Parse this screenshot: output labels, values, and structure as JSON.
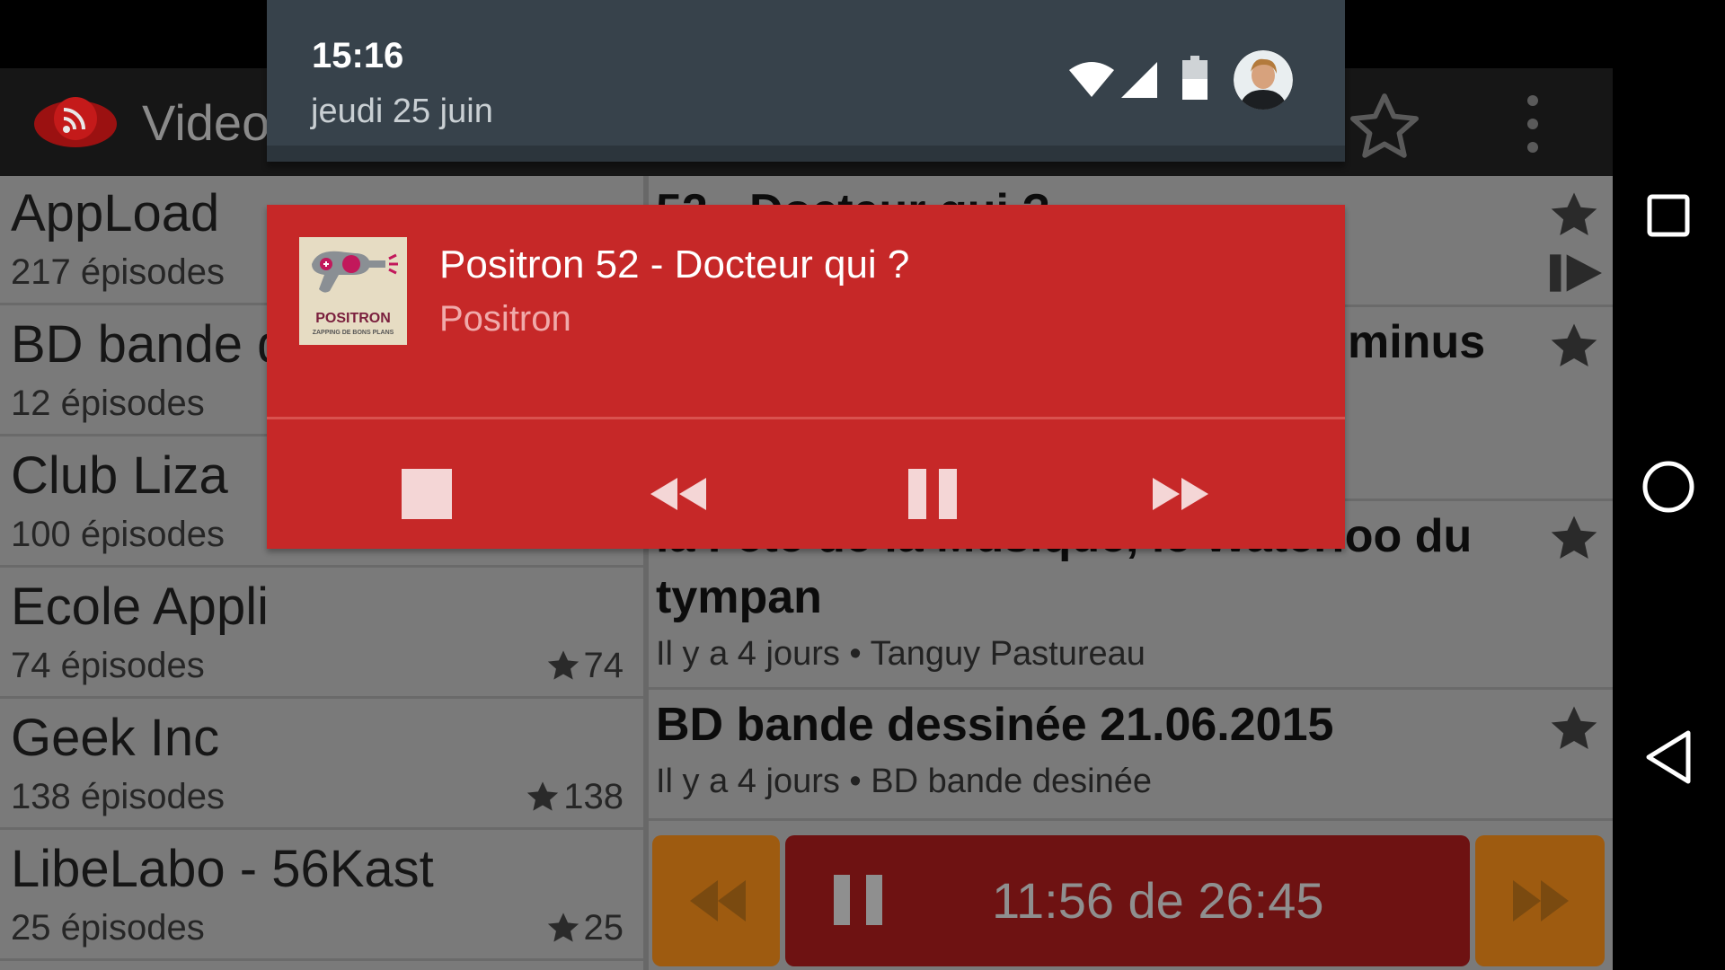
{
  "app": {
    "title": "Video",
    "feeds": [
      {
        "title": "AppLoad",
        "episodes": "217 épisodes",
        "starred": ""
      },
      {
        "title": "BD bande dessinée",
        "episodes": "12 épisodes",
        "starred": ""
      },
      {
        "title": "Club Liza",
        "episodes": "100 épisodes",
        "starred": ""
      },
      {
        "title": "Ecole Appli",
        "episodes": "74 épisodes",
        "starred": "74"
      },
      {
        "title": "Geek Inc",
        "episodes": "138 épisodes",
        "starred": "138"
      },
      {
        "title": "LibeLabo - 56Kast",
        "episodes": "25 épisodes",
        "starred": "25"
      }
    ],
    "episodes": [
      {
        "title": "52 - Docteur qui ?",
        "meta": ""
      },
      {
        "title": "minus",
        "meta": ""
      },
      {
        "title": "la Fête de la Musique, le Waterloo du",
        "title2": "tympan",
        "meta": "Il y a 4 jours • Tanguy Pastureau"
      },
      {
        "title": "BD bande dessinée 21.06.2015",
        "meta": "Il y a 4 jours • BD bande desinée"
      }
    ],
    "player": {
      "time": "11:56 de 26:45"
    }
  },
  "shade": {
    "time": "15:16",
    "date": "jeudi 25 juin"
  },
  "notification": {
    "title": "Positron 52 - Docteur qui ?",
    "subtitle": "Positron",
    "art_label": "POSITRON",
    "art_sub": "ZAPPING DE BONS PLANS"
  },
  "colors": {
    "notification_bg": "#c62828",
    "shade_header_bg": "#37424b",
    "player_accent": "#9e5b10",
    "player_main": "#6e1212"
  }
}
